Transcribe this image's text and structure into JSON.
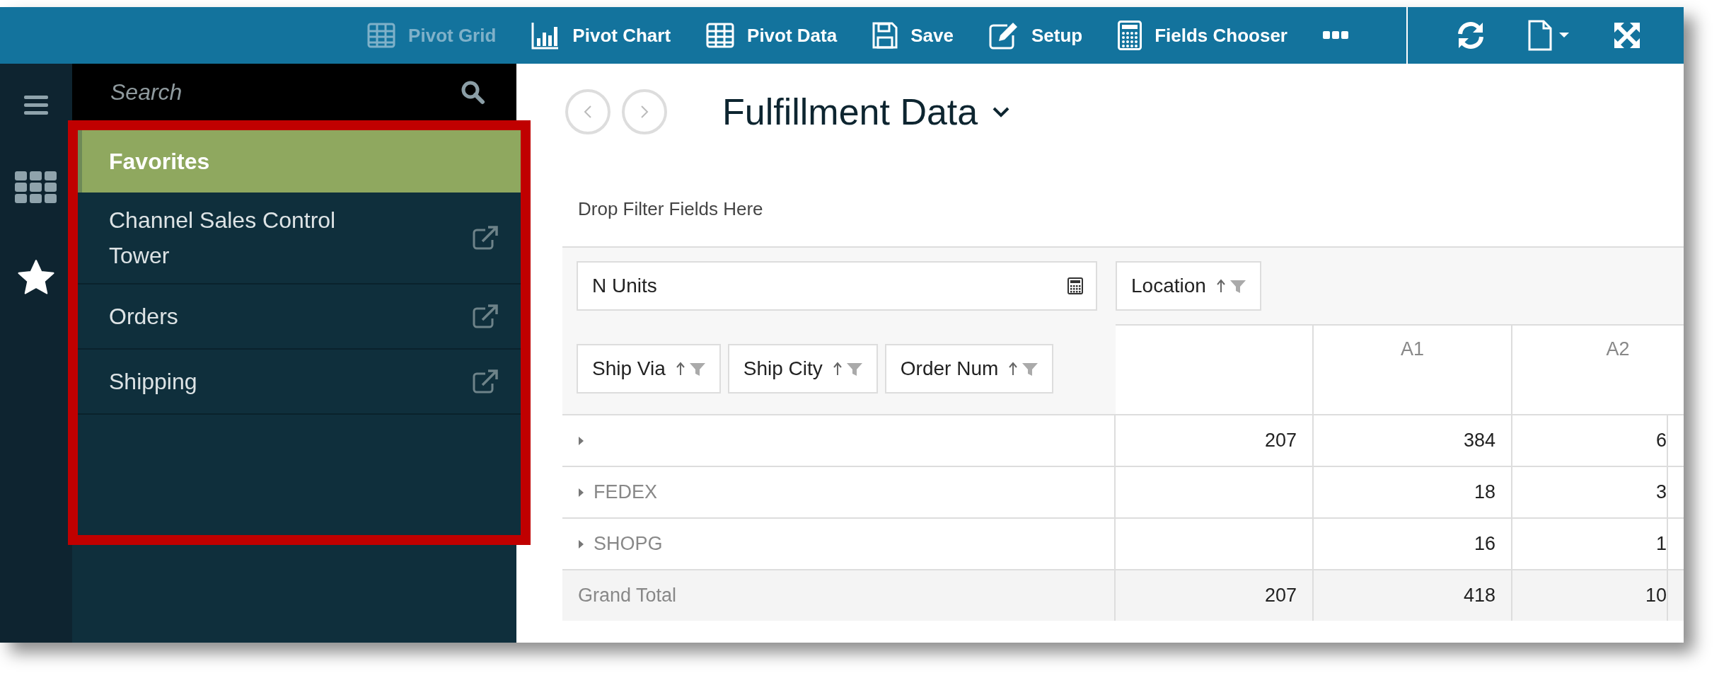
{
  "toolbar": {
    "items": [
      {
        "kind": "grid",
        "label": "Pivot Grid",
        "selected": true
      },
      {
        "kind": "chart",
        "label": "Pivot Chart",
        "selected": false
      },
      {
        "kind": "table",
        "label": "Pivot Data",
        "selected": false
      },
      {
        "kind": "save",
        "label": "Save",
        "selected": false
      },
      {
        "kind": "edit",
        "label": "Setup",
        "selected": false
      },
      {
        "kind": "calculator",
        "label": "Fields Chooser",
        "selected": false
      },
      {
        "kind": "more",
        "selected": false
      }
    ],
    "actions": [
      {
        "kind": "refresh"
      },
      {
        "kind": "document"
      },
      {
        "kind": "fullscreen"
      }
    ]
  },
  "rail": {
    "items": [
      {
        "kind": "menu",
        "selected": false
      },
      {
        "kind": "apps",
        "selected": false
      },
      {
        "kind": "star",
        "selected": true
      }
    ]
  },
  "search": {
    "placeholder": "Search"
  },
  "favorites": {
    "title": "Favorites",
    "items": [
      {
        "label": "Channel Sales Control Tower"
      },
      {
        "label": "Orders"
      },
      {
        "label": "Shipping"
      }
    ]
  },
  "report": {
    "title": "Fulfillment Data",
    "filter_hint": "Drop Filter Fields Here",
    "data_field": "N Units",
    "column_fields": [
      "Location"
    ],
    "row_fields": [
      "Ship Via",
      "Ship City",
      "Order Num"
    ],
    "table": {
      "columns": [
        "A1",
        "A2"
      ],
      "rows": [
        {
          "kind": "group",
          "cells": [
            "207",
            "384",
            "6"
          ]
        },
        {
          "kind": "group",
          "label": "FEDEX",
          "cells": [
            null,
            "18",
            "3"
          ]
        },
        {
          "kind": "group",
          "label": "SHOPG",
          "cells": [
            null,
            "16",
            "1"
          ]
        },
        {
          "kind": "total",
          "label": "Grand Total",
          "cells": [
            "207",
            "418",
            "10"
          ]
        }
      ]
    }
  }
}
